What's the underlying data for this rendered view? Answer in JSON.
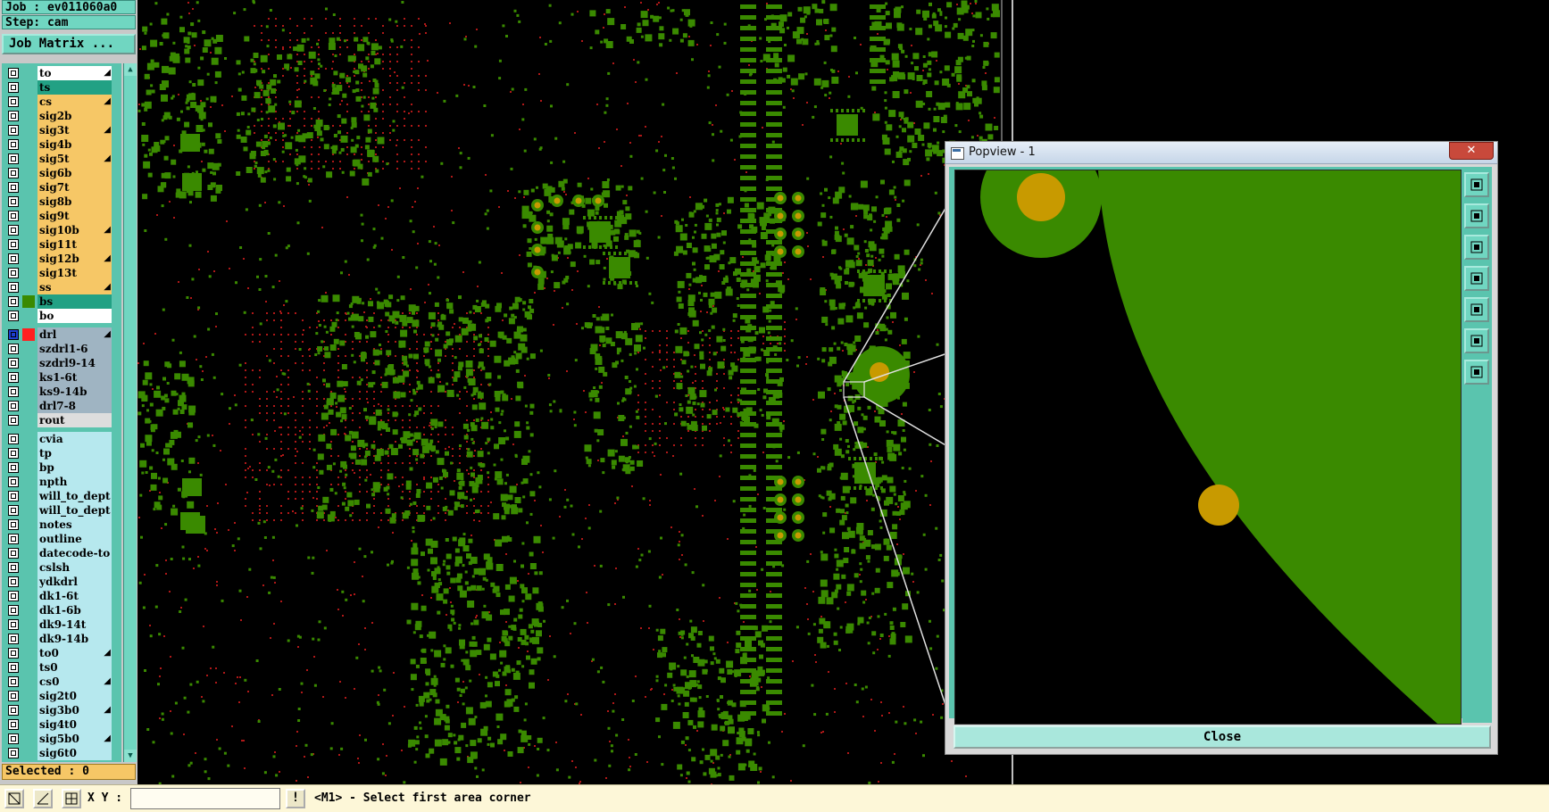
{
  "header": {
    "job_label": "Job : ev011060a0",
    "step_label": "Step: cam"
  },
  "job_matrix_button_label": "Job Matrix ...",
  "layers": [
    {
      "name": "to",
      "color": "#ffffff",
      "flag": true
    },
    {
      "name": "ts",
      "color": "#22a184",
      "flag": false
    },
    {
      "name": "cs",
      "color": "#f6c766",
      "flag": true
    },
    {
      "name": "sig2b",
      "color": "#f6c766",
      "flag": false
    },
    {
      "name": "sig3t",
      "color": "#f6c766",
      "flag": true
    },
    {
      "name": "sig4b",
      "color": "#f6c766",
      "flag": false
    },
    {
      "name": "sig5t",
      "color": "#f6c766",
      "flag": true
    },
    {
      "name": "sig6b",
      "color": "#f6c766",
      "flag": false
    },
    {
      "name": "sig7t",
      "color": "#f6c766",
      "flag": false
    },
    {
      "name": "sig8b",
      "color": "#f6c766",
      "flag": false
    },
    {
      "name": "sig9t",
      "color": "#f6c766",
      "flag": false
    },
    {
      "name": "sig10b",
      "color": "#f6c766",
      "flag": true
    },
    {
      "name": "sig11t",
      "color": "#f6c766",
      "flag": false
    },
    {
      "name": "sig12b",
      "color": "#f6c766",
      "flag": true
    },
    {
      "name": "sig13t",
      "color": "#f6c766",
      "flag": false
    },
    {
      "name": "ss",
      "color": "#f6c766",
      "flag": true
    },
    {
      "name": "bs",
      "color": "#22a184",
      "flag": false,
      "swatch": "#3a8a00"
    },
    {
      "name": "bo",
      "color": "#ffffff",
      "flag": false
    },
    {
      "name": "drl",
      "color": "#9fb4c2",
      "flag": true,
      "swatch": "#ff2020",
      "drill": true
    },
    {
      "name": "szdrl1-6",
      "color": "#9fb4c2",
      "flag": false
    },
    {
      "name": "szdrl9-14",
      "color": "#9fb4c2",
      "flag": false
    },
    {
      "name": "ks1-6t",
      "color": "#9fb4c2",
      "flag": false
    },
    {
      "name": "ks9-14b",
      "color": "#9fb4c2",
      "flag": false
    },
    {
      "name": "drl7-8",
      "color": "#9fb4c2",
      "flag": false
    },
    {
      "name": "rout",
      "color": "#dddddd",
      "flag": false
    },
    {
      "name": "cvia",
      "color": "#b6e8ee",
      "flag": false
    },
    {
      "name": "tp",
      "color": "#b6e8ee",
      "flag": false
    },
    {
      "name": "bp",
      "color": "#b6e8ee",
      "flag": false
    },
    {
      "name": "npth",
      "color": "#b6e8ee",
      "flag": false
    },
    {
      "name": "will_to_dept",
      "color": "#b6e8ee",
      "flag": false
    },
    {
      "name": "will_to_dept",
      "color": "#b6e8ee",
      "flag": false
    },
    {
      "name": "notes",
      "color": "#b6e8ee",
      "flag": false
    },
    {
      "name": "outline",
      "color": "#b6e8ee",
      "flag": false
    },
    {
      "name": "datecode-to",
      "color": "#b6e8ee",
      "flag": false
    },
    {
      "name": "cslsh",
      "color": "#b6e8ee",
      "flag": false
    },
    {
      "name": "ydkdrl",
      "color": "#b6e8ee",
      "flag": false
    },
    {
      "name": "dk1-6t",
      "color": "#b6e8ee",
      "flag": false
    },
    {
      "name": "dk1-6b",
      "color": "#b6e8ee",
      "flag": false
    },
    {
      "name": "dk9-14t",
      "color": "#b6e8ee",
      "flag": false
    },
    {
      "name": "dk9-14b",
      "color": "#b6e8ee",
      "flag": false
    },
    {
      "name": "to0",
      "color": "#b6e8ee",
      "flag": true
    },
    {
      "name": "ts0",
      "color": "#b6e8ee",
      "flag": false
    },
    {
      "name": "cs0",
      "color": "#b6e8ee",
      "flag": true
    },
    {
      "name": "sig2t0",
      "color": "#b6e8ee",
      "flag": false
    },
    {
      "name": "sig3b0",
      "color": "#b6e8ee",
      "flag": true
    },
    {
      "name": "sig4t0",
      "color": "#b6e8ee",
      "flag": false
    },
    {
      "name": "sig5b0",
      "color": "#b6e8ee",
      "flag": true
    },
    {
      "name": "sig6t0",
      "color": "#b6e8ee",
      "flag": false
    }
  ],
  "selected_label": "Selected : 0",
  "popview": {
    "title": "Popview - 1",
    "close_x": "✕",
    "close_button_label": "Close",
    "toolbar_icons": [
      "zoom-home-icon",
      "zoom-in-icon",
      "zoom-out-icon",
      "pan-left-icon",
      "pan-right-icon",
      "fit-screen-icon",
      "pan-all-icon"
    ]
  },
  "statusbar": {
    "xy_label": "X Y :",
    "xy_value": "",
    "warning_glyph": "!",
    "message": "<M1> - Select first area corner"
  },
  "colors": {
    "copper": "#3a8a00",
    "pad": "#c89a00",
    "drill_dot": "#b01818",
    "panel": "#5ac4ae"
  }
}
